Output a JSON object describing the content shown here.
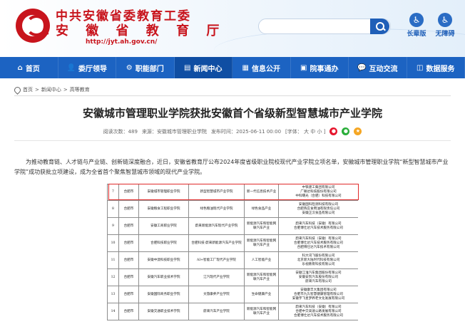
{
  "header": {
    "title_line1": "中共安徽省委教育工委",
    "title_line2": "安 徽 省 教 育 厅",
    "url": "http://jyt.ah.gov.cn/",
    "search_placeholder": "",
    "tools": [
      {
        "label": "长辈版",
        "icon": "elder-mode-icon",
        "glyph": "♿"
      },
      {
        "label": "无障碍",
        "icon": "accessibility-icon",
        "glyph": "♿"
      }
    ]
  },
  "nav": {
    "items": [
      {
        "label": "首页",
        "icon": "home-icon",
        "glyph": "⌂"
      },
      {
        "label": "委厅领导",
        "icon": "leaders-icon",
        "glyph": "👤"
      },
      {
        "label": "职能部门",
        "icon": "departments-icon",
        "glyph": "⚙"
      },
      {
        "label": "新闻中心",
        "icon": "news-icon",
        "glyph": "▤"
      },
      {
        "label": "信息公开",
        "icon": "info-icon",
        "glyph": "▦"
      },
      {
        "label": "院事通办",
        "icon": "service-icon",
        "glyph": "▣"
      },
      {
        "label": "互动交流",
        "icon": "chat-icon",
        "glyph": "💬"
      },
      {
        "label": "数据服务",
        "icon": "data-icon",
        "glyph": "◫"
      }
    ],
    "active_index": 3
  },
  "breadcrumb": {
    "items": [
      "首页",
      "新闻中心",
      "高等教育"
    ],
    "separator": ">"
  },
  "article": {
    "title": "安徽城市管理职业学院获批安徽首个省级新型智慧城市产业学院",
    "meta": {
      "views_label": "阅读次数：",
      "views": "489",
      "source_label": "来源：",
      "source": "安徽城市管理职业学院",
      "date_label": "发布时间：",
      "date": "2025-06-11 00:00",
      "font_label": "[字体：",
      "font_sizes": [
        "大",
        "中",
        "小"
      ],
      "font_end": "]"
    },
    "paragraph": "为推动教育链、人才链与产业链、创新链深度融合，近日，安徽省教育厅公布2024年度省级职业院校现代产业学院立项名单，安徽城市管理职业学院“新型智慧城市产业学院”成功获批立项建设，成为全省首个聚焦智慧城市领域的现代产业学院。"
  },
  "table_rows": [
    [
      "7",
      "合肥市",
      "安徽城市管理职业学院",
      "新型智慧城市产业学院",
      "新一代信息技术产业",
      "中铁建工集团有限公司\n广联达科技股份有限公司\n中科曙光（合肥）科技有限公司"
    ],
    [
      "8",
      "合肥市",
      "安徽粮食工程职业学院",
      "绿色粮油现代产业学院",
      "绿色食品产业",
      "安徽国科检测科技有限公司\n合肥燕庄食用油有限责任公司\n安徽正汉食品有限公司"
    ],
    [
      "9",
      "合肥市",
      "安徽工商职业学院",
      "蔚来新能源汽车现代产业学院",
      "新能源汽车和智能网联汽车产业",
      "蔚来汽车科技（安徽）有限公司\n合肥博仕达汽车技术服务有限公司"
    ],
    [
      "10",
      "合肥市",
      "合肥科技职业学院",
      "合肥科技·蔚来新能源汽车产业学院",
      "新能源汽车和智能网联汽车产业",
      "蔚来汽车科技（安徽）有限公司\n合肥博仕达汽车技术服务有限公司\n合肥博仕达汽车技术有限公司"
    ],
    [
      "11",
      "合肥市",
      "安徽中澳科技职业学院",
      "AI+智能工厂现代产业学院",
      "人工智能产业",
      "科大讯飞股份有限公司\n北京新大陆时代科技有限公司\n乐视教育科技有限公司"
    ],
    [
      "12",
      "合肥市",
      "安徽汽车职业技术学院",
      "江汽现代产业学院",
      "新能源汽车和智能网联汽车产业",
      "安徽江淮汽车集团股份有限公司\n安徽安凯汽车股份有限公司\n蔚来汽车有限公司"
    ],
    [
      "13",
      "合肥市",
      "安徽国际商务职业学院",
      "文旅康养产业学院",
      "生命健康产业",
      "安徽康丰大集团有限公司\n合肥市九久智慧健康管理有限公司\n安徽宇飞星梦养老文化发展有限公司"
    ],
    [
      "14",
      "合肥市",
      "安徽交通职业技术学院",
      "蔚来汽车产业学院",
      "新能源汽车和智能网联汽车产业",
      "蔚来汽车科技（安徽）有限公司\n合肥中交高速公路发展有限公司\n合肥博仕达汽车技术服务有限公司"
    ]
  ],
  "colors": {
    "brand_red": "#c8141c",
    "nav_blue": "#1c63c2",
    "nav_active": "#0f4ea3",
    "highlight_border": "#e02a2a"
  }
}
